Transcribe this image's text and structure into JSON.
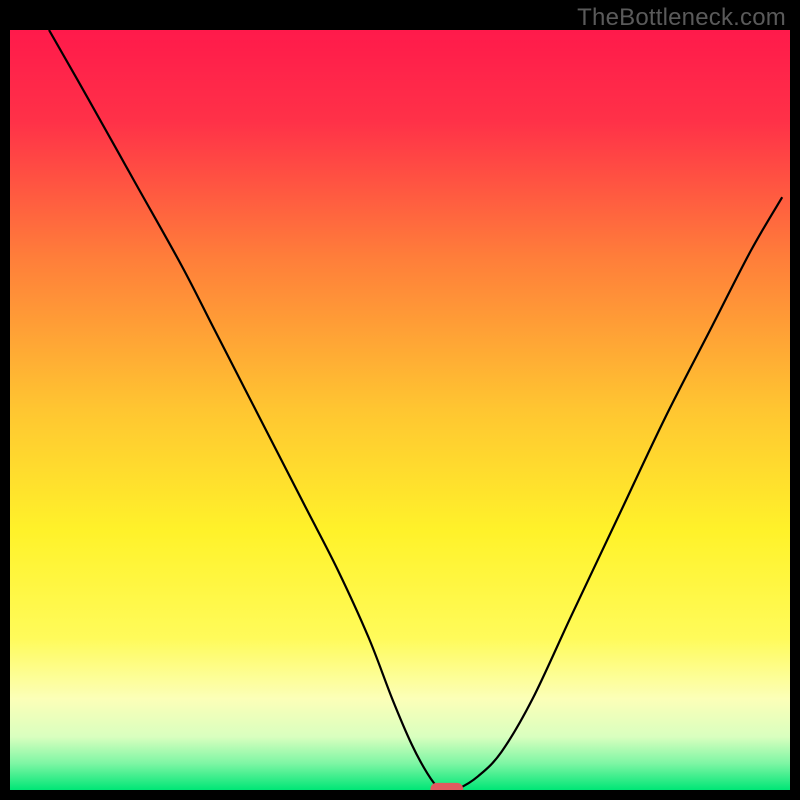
{
  "watermark": "TheBottleneck.com",
  "chart_data": {
    "type": "line",
    "title": "",
    "xlabel": "",
    "ylabel": "",
    "xlim": [
      0,
      100
    ],
    "ylim": [
      0,
      100
    ],
    "grid": false,
    "legend": false,
    "gradient_stops": [
      {
        "offset": 0.0,
        "color": "#ff1a4b"
      },
      {
        "offset": 0.12,
        "color": "#ff3148"
      },
      {
        "offset": 0.3,
        "color": "#ff7e3a"
      },
      {
        "offset": 0.5,
        "color": "#ffc631"
      },
      {
        "offset": 0.66,
        "color": "#fff22a"
      },
      {
        "offset": 0.8,
        "color": "#fffb5a"
      },
      {
        "offset": 0.88,
        "color": "#fcffb8"
      },
      {
        "offset": 0.93,
        "color": "#d9ffbf"
      },
      {
        "offset": 0.965,
        "color": "#7ef6a4"
      },
      {
        "offset": 1.0,
        "color": "#00e676"
      }
    ],
    "series": [
      {
        "name": "bottleneck-curve",
        "color": "#000000",
        "width": 2.2,
        "x": [
          5,
          10,
          16,
          22,
          26,
          30,
          34,
          38,
          42,
          46,
          49,
          51.5,
          53.5,
          55,
          56,
          57.5,
          60,
          63,
          67,
          72,
          78,
          84,
          90,
          95,
          99
        ],
        "y": [
          100,
          91,
          80,
          69,
          61,
          53,
          45,
          37,
          29,
          20,
          12,
          6,
          2.2,
          0.2,
          0,
          0.2,
          1.8,
          5,
          12,
          23,
          36,
          49,
          61,
          71,
          78
        ]
      }
    ],
    "marker": {
      "shape": "pill",
      "x": 56,
      "y": 0,
      "width_pct": 4.2,
      "height_pct": 1.6,
      "fill": "#e05a5f"
    }
  }
}
